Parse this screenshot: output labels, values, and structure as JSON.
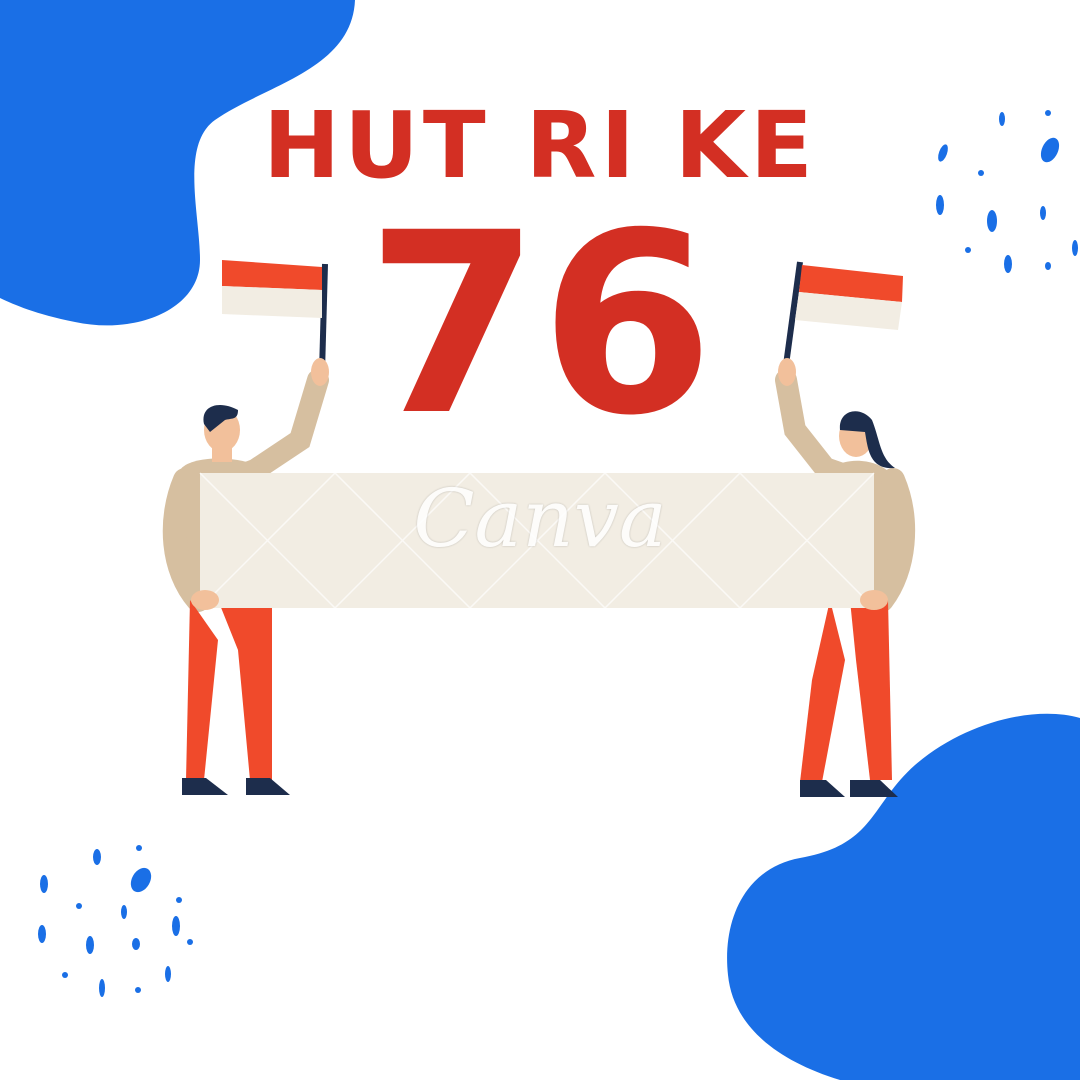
{
  "poster": {
    "headline": "HUT RI KE",
    "number": "76",
    "watermark": "Canva"
  },
  "colors": {
    "blue": "#1a6fe6",
    "red": "#d32f23",
    "flag_red": "#f04a2b",
    "banner": "#f2ede3",
    "skin": "#f2c09b",
    "shirt": "#d6bfa0",
    "pants": "#f04a2b",
    "hair": "#1d2d4c"
  }
}
